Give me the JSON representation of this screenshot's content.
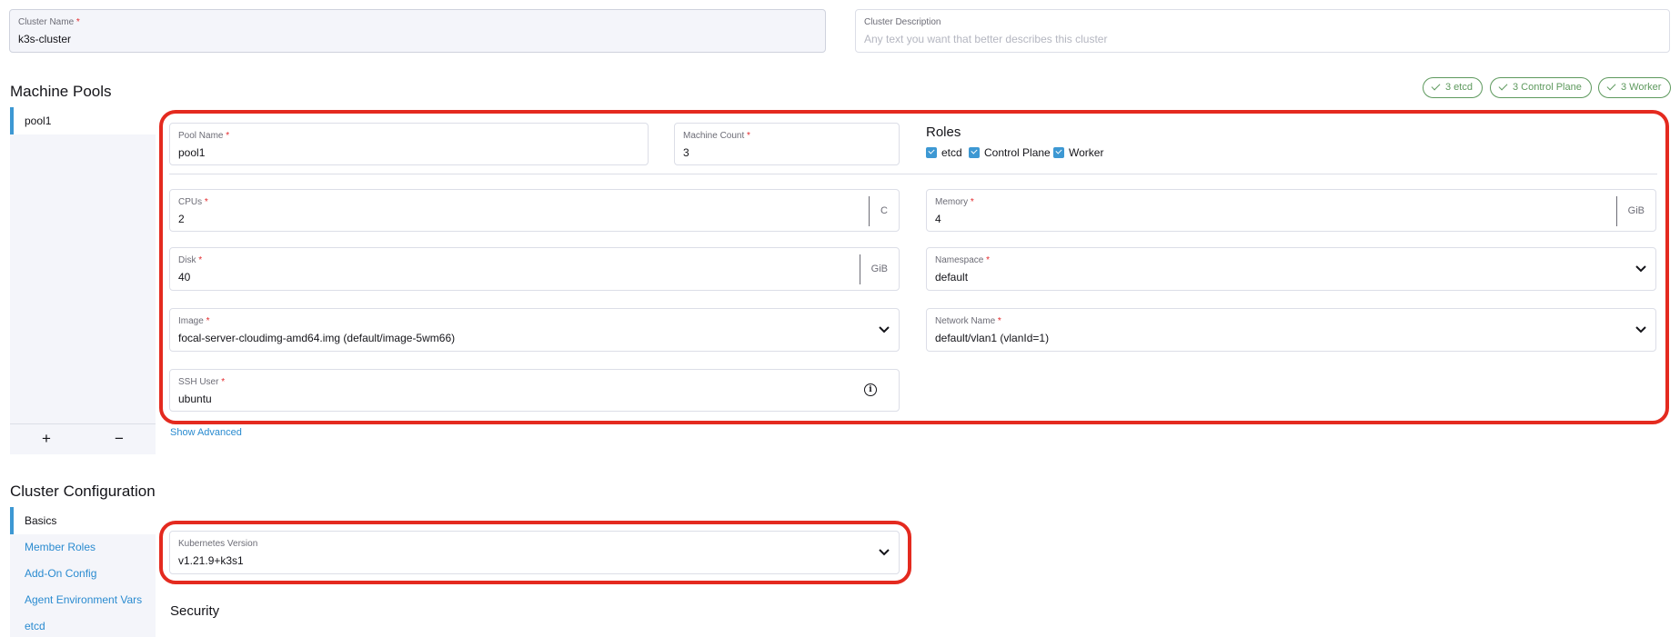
{
  "cluster": {
    "name_label": "Cluster Name",
    "name_value": "k3s-cluster",
    "desc_label": "Cluster Description",
    "desc_placeholder": "Any text you want that better describes this cluster"
  },
  "machine_pools": {
    "title": "Machine Pools",
    "badges": [
      "3 etcd",
      "3 Control Plane",
      "3 Worker"
    ],
    "pools": [
      "pool1"
    ],
    "add_label": "+",
    "remove_label": "−",
    "pool": {
      "pool_name_label": "Pool Name",
      "pool_name_value": "pool1",
      "machine_count_label": "Machine Count",
      "machine_count_value": "3",
      "roles_title": "Roles",
      "roles": [
        "etcd",
        "Control Plane",
        "Worker"
      ],
      "cpus_label": "CPUs",
      "cpus_value": "2",
      "cpus_unit": "C",
      "memory_label": "Memory",
      "memory_value": "4",
      "memory_unit": "GiB",
      "disk_label": "Disk",
      "disk_value": "40",
      "disk_unit": "GiB",
      "namespace_label": "Namespace",
      "namespace_value": "default",
      "image_label": "Image",
      "image_value": "focal-server-cloudimg-amd64.img (default/image-5wm66)",
      "network_label": "Network Name",
      "network_value": "default/vlan1 (vlanId=1)",
      "ssh_label": "SSH User",
      "ssh_value": "ubuntu",
      "show_advanced": "Show Advanced"
    }
  },
  "cluster_config": {
    "title": "Cluster Configuration",
    "nav": [
      "Basics",
      "Member Roles",
      "Add-On Config",
      "Agent Environment Vars",
      "etcd"
    ],
    "k8s_label": "Kubernetes Version",
    "k8s_value": "v1.21.9+k3s1",
    "security_title": "Security"
  },
  "required_mark": "*",
  "colors": {
    "accent": "#3d98d3",
    "link": "#2a8bd0",
    "success": "#5d995d",
    "required": "#e3292c",
    "highlight": "#e42a1f",
    "sidebar_bg": "#f4f5fa"
  }
}
